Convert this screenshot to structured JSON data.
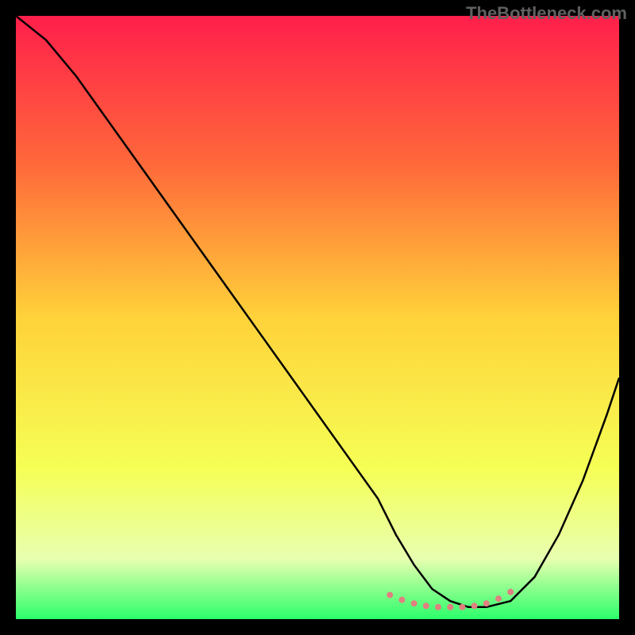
{
  "watermark": "TheBottleneck.com",
  "chart_data": {
    "type": "line",
    "title": "",
    "xlabel": "",
    "ylabel": "",
    "xlim": [
      0,
      100
    ],
    "ylim": [
      0,
      100
    ],
    "gradient_stops": [
      {
        "offset": 0,
        "color": "#ff1f4b"
      },
      {
        "offset": 25,
        "color": "#ff6a3a"
      },
      {
        "offset": 50,
        "color": "#ffd23a"
      },
      {
        "offset": 75,
        "color": "#f5ff55"
      },
      {
        "offset": 90,
        "color": "#e8ffb0"
      },
      {
        "offset": 100,
        "color": "#2bff6a"
      }
    ],
    "series": [
      {
        "name": "bottleneck-curve",
        "color": "#000000",
        "x": [
          0,
          5,
          10,
          15,
          20,
          25,
          30,
          35,
          40,
          45,
          50,
          55,
          60,
          63,
          66,
          69,
          72,
          75,
          78,
          82,
          86,
          90,
          94,
          98,
          100
        ],
        "y": [
          100,
          96,
          90,
          83,
          76,
          69,
          62,
          55,
          48,
          41,
          34,
          27,
          20,
          14,
          9,
          5,
          3,
          2,
          2,
          3,
          7,
          14,
          23,
          34,
          40
        ]
      },
      {
        "name": "min-marker",
        "color": "#e08080",
        "style": "dotted",
        "x": [
          62,
          64,
          66,
          68,
          70,
          72,
          74,
          76,
          78,
          80,
          82
        ],
        "y": [
          4,
          3.2,
          2.6,
          2.2,
          2.0,
          2.0,
          2.0,
          2.2,
          2.6,
          3.4,
          4.5
        ]
      }
    ]
  }
}
